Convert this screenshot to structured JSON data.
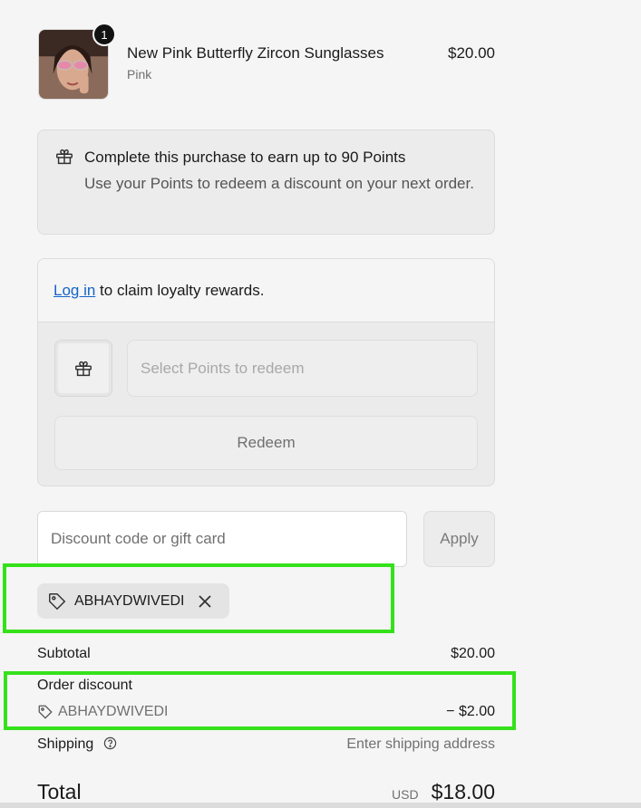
{
  "product": {
    "name": "New Pink Butterfly Zircon Sunglasses",
    "variant": "Pink",
    "price": "$20.00",
    "quantity": "1"
  },
  "points_banner": {
    "title": "Complete this purchase to earn up to 90 Points",
    "subtitle": "Use your Points to redeem a discount on your next order."
  },
  "loyalty": {
    "login_link": "Log in",
    "login_text": " to claim loyalty rewards.",
    "select_placeholder": "Select Points to redeem",
    "redeem_label": "Redeem"
  },
  "discount": {
    "placeholder": "Discount code or gift card",
    "apply_label": "Apply",
    "applied_code": "ABHAYDWIVEDI"
  },
  "summary": {
    "subtotal_label": "Subtotal",
    "subtotal_value": "$20.00",
    "order_discount_label": "Order discount",
    "order_discount_code": "ABHAYDWIVEDI",
    "order_discount_value": "− $2.00",
    "shipping_label": "Shipping",
    "shipping_value": "Enter shipping address",
    "total_label": "Total",
    "total_currency": "USD",
    "total_value": "$18.00"
  },
  "icons": {
    "gift": "gift-icon",
    "tag": "tag-icon",
    "close": "close-icon",
    "help": "help-circle-icon"
  },
  "colors": {
    "highlight": "#35e11b",
    "link": "#1464c8"
  }
}
